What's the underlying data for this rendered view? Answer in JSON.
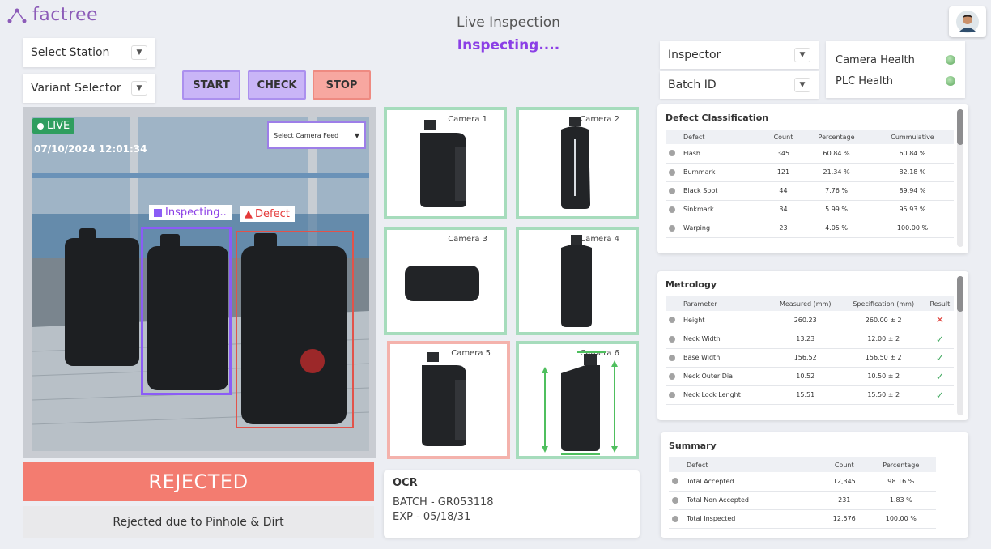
{
  "header": {
    "logo_text": "factree",
    "title": "Live Inspection",
    "status": "Inspecting...."
  },
  "selectors": {
    "station": "Select Station",
    "variant": "Variant Selector",
    "inspector": "Inspector",
    "batch": "Batch ID"
  },
  "buttons": {
    "start": "START",
    "check": "CHECK",
    "stop": "STOP"
  },
  "feed": {
    "live": "LIVE",
    "timestamp": "07/10/2024  12:01:34",
    "camera_select": "Select Camera Feed",
    "inspecting_label": "Inspecting..",
    "defect_label": "Defect",
    "result": "REJECTED",
    "reason": "Rejected due to Pinhole & Dirt"
  },
  "cameras": [
    {
      "label": "Camera 1",
      "status": "ok"
    },
    {
      "label": "Camera 2",
      "status": "ok"
    },
    {
      "label": "Camera 3",
      "status": "ok"
    },
    {
      "label": "Camera 4",
      "status": "ok"
    },
    {
      "label": "Camera 5",
      "status": "defect"
    },
    {
      "label": "Camera 6",
      "status": "ok"
    }
  ],
  "ocr": {
    "title": "OCR",
    "batch": "BATCH - GR053118",
    "exp": "EXP - 05/18/31"
  },
  "health": {
    "camera": "Camera Health",
    "plc": "PLC Health"
  },
  "defects": {
    "title": "Defect Classification",
    "headers": [
      "Defect",
      "Count",
      "Percentage",
      "Cummulative"
    ],
    "rows": [
      [
        "Flash",
        "345",
        "60.84 %",
        "60.84 %"
      ],
      [
        "Burnmark",
        "121",
        "21.34 %",
        "82.18 %"
      ],
      [
        "Black Spot",
        "44",
        "7.76 %",
        "89.94 %"
      ],
      [
        "Sinkmark",
        "34",
        "5.99 %",
        "95.93 %"
      ],
      [
        "Warping",
        "23",
        "4.05 %",
        "100.00 %"
      ]
    ]
  },
  "metrology": {
    "title": "Metrology",
    "headers": [
      "Parameter",
      "Measured (mm)",
      "Specification (mm)",
      "Result"
    ],
    "rows": [
      [
        "Height",
        "260.23",
        "260.00 ± 2",
        "fail"
      ],
      [
        "Neck Width",
        "13.23",
        "12.00 ± 2",
        "pass"
      ],
      [
        "Base Width",
        "156.52",
        "156.50 ± 2",
        "pass"
      ],
      [
        "Neck Outer Dia",
        "10.52",
        "10.50 ± 2",
        "pass"
      ],
      [
        "Neck Lock Lenght",
        "15.51",
        "15.50 ± 2",
        "pass"
      ]
    ]
  },
  "summary": {
    "title": "Summary",
    "headers": [
      "Defect",
      "Count",
      "Percentage"
    ],
    "rows": [
      [
        "Total Accepted",
        "12,345",
        "98.16 %"
      ],
      [
        "Total Non Accepted",
        "231",
        "1.83 %"
      ],
      [
        "Total Inspected",
        "12,576",
        "100.00 %"
      ]
    ]
  },
  "colors": {
    "accent": "#8b3fe6",
    "ok_border": "#a6dcbc",
    "defect_border": "#f4b2ac",
    "rejected": "#f37c70"
  }
}
